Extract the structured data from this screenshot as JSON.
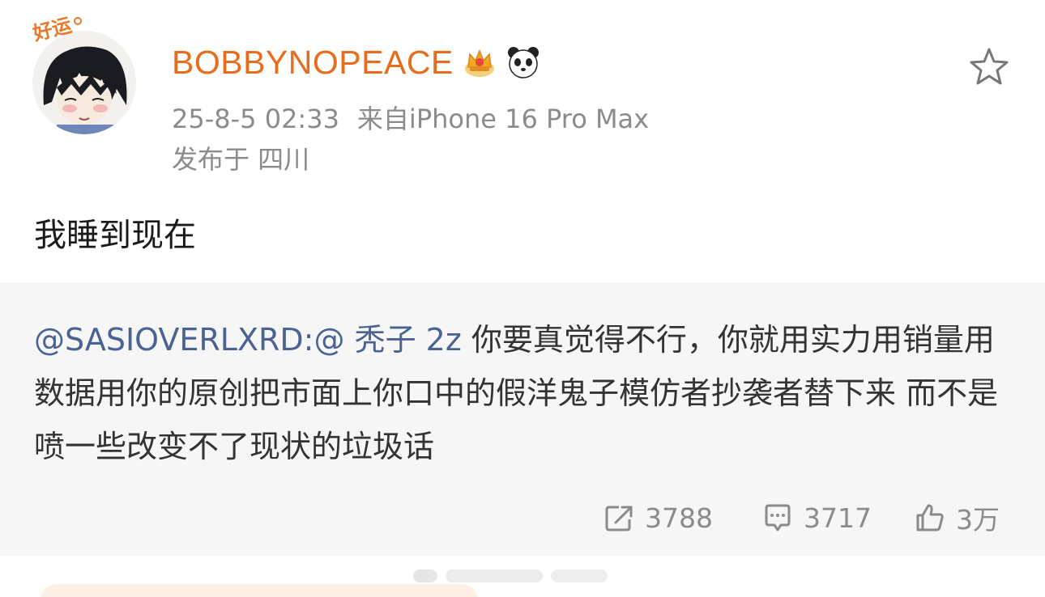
{
  "post": {
    "username": "BOBBYNOPEACE",
    "avatar_badge_text": "好运",
    "timestamp": "25-8-5 02:33",
    "source": "来自iPhone 16 Pro Max",
    "location": "发布于 四川",
    "text": "我睡到现在"
  },
  "retweet": {
    "mention_user": "@SASIOVERLXRD:",
    "mention_inline": "@ 秃子 2z",
    "body": " 你要真觉得不行，你就用实力用销量用数据用你的原创把市面上你口中的假洋鬼子模仿者抄袭者替下来  而不是喷一些改变不了现状的垃圾话"
  },
  "actions": {
    "repost_count": "3788",
    "comment_count": "3717",
    "like_count": "3万"
  },
  "colors": {
    "username": "#e86c1d",
    "mention": "#4a6393",
    "meta": "#8b8b8b",
    "retweet_bg": "#f6f6f6"
  },
  "icons": [
    "crown-badge-icon",
    "panda-badge-icon",
    "star-icon",
    "repost-icon",
    "comment-icon",
    "like-icon"
  ]
}
